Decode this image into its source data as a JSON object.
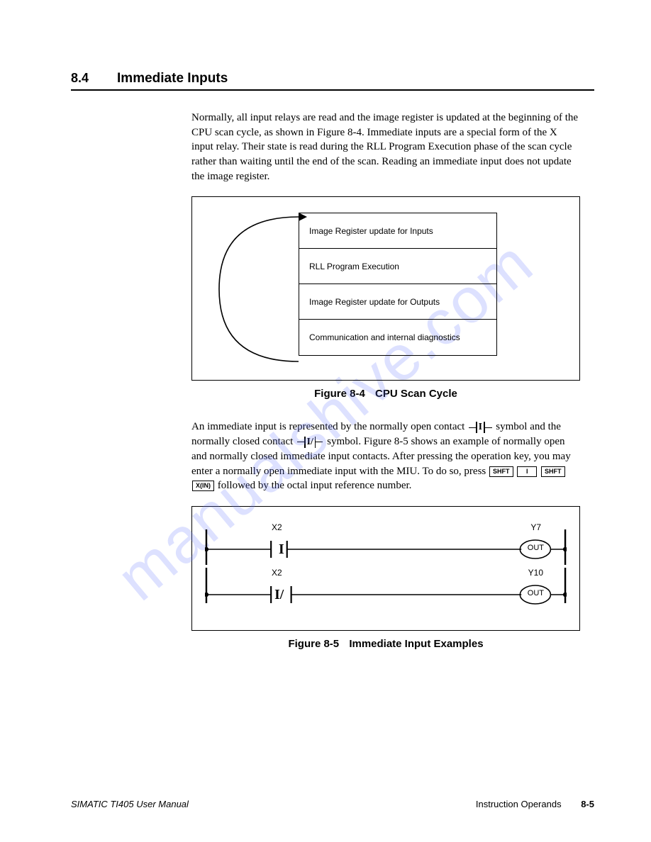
{
  "section": {
    "number": "8.4",
    "title": "Immediate Inputs"
  },
  "para1": "Normally, all input relays are read and the image register is updated at the beginning of the CPU scan cycle, as shown in Figure 8-4. Immediate inputs are a special form of the X input relay. Their state is read during the RLL Program Execution phase of the scan cycle rather than waiting until the end of the scan. Reading an immediate input does not update the image register.",
  "cycle": {
    "rows": [
      "Image Register update for Inputs",
      "RLL Program Execution",
      "Image Register update for Outputs",
      "Communication and internal diagnostics"
    ]
  },
  "fig4": {
    "label": "Figure 8-4",
    "title": "CPU Scan Cycle"
  },
  "para2a": "An immediate input is represented by the normally open contact ",
  "para2b": " symbol and the normally closed contact ",
  "para2c": " symbol. Figure 8-5 shows an example of normally open and normally closed immediate input contacts. After pressing the operation key, you may enter a normally open immediate input with the MIU. To do so, press ",
  "para2d": " followed by the octal input reference number.",
  "keys": {
    "k1": "SHFT",
    "k2": "I",
    "k3": "SHFT",
    "k4": "X(IN)"
  },
  "ladder": {
    "rung1": {
      "contact_label": "X2",
      "contact_text": "I",
      "out_label": "Y7",
      "out_text": "OUT"
    },
    "rung2": {
      "contact_label": "X2",
      "contact_text": "I/",
      "out_label": "Y10",
      "out_text": "OUT"
    }
  },
  "fig5": {
    "label": "Figure 8-5",
    "title": "Immediate Input Examples"
  },
  "footer": {
    "left": "SIMATIC TI405 User Manual",
    "right": "Instruction Operands",
    "page": "8-5"
  },
  "watermark": "manualshive.com"
}
